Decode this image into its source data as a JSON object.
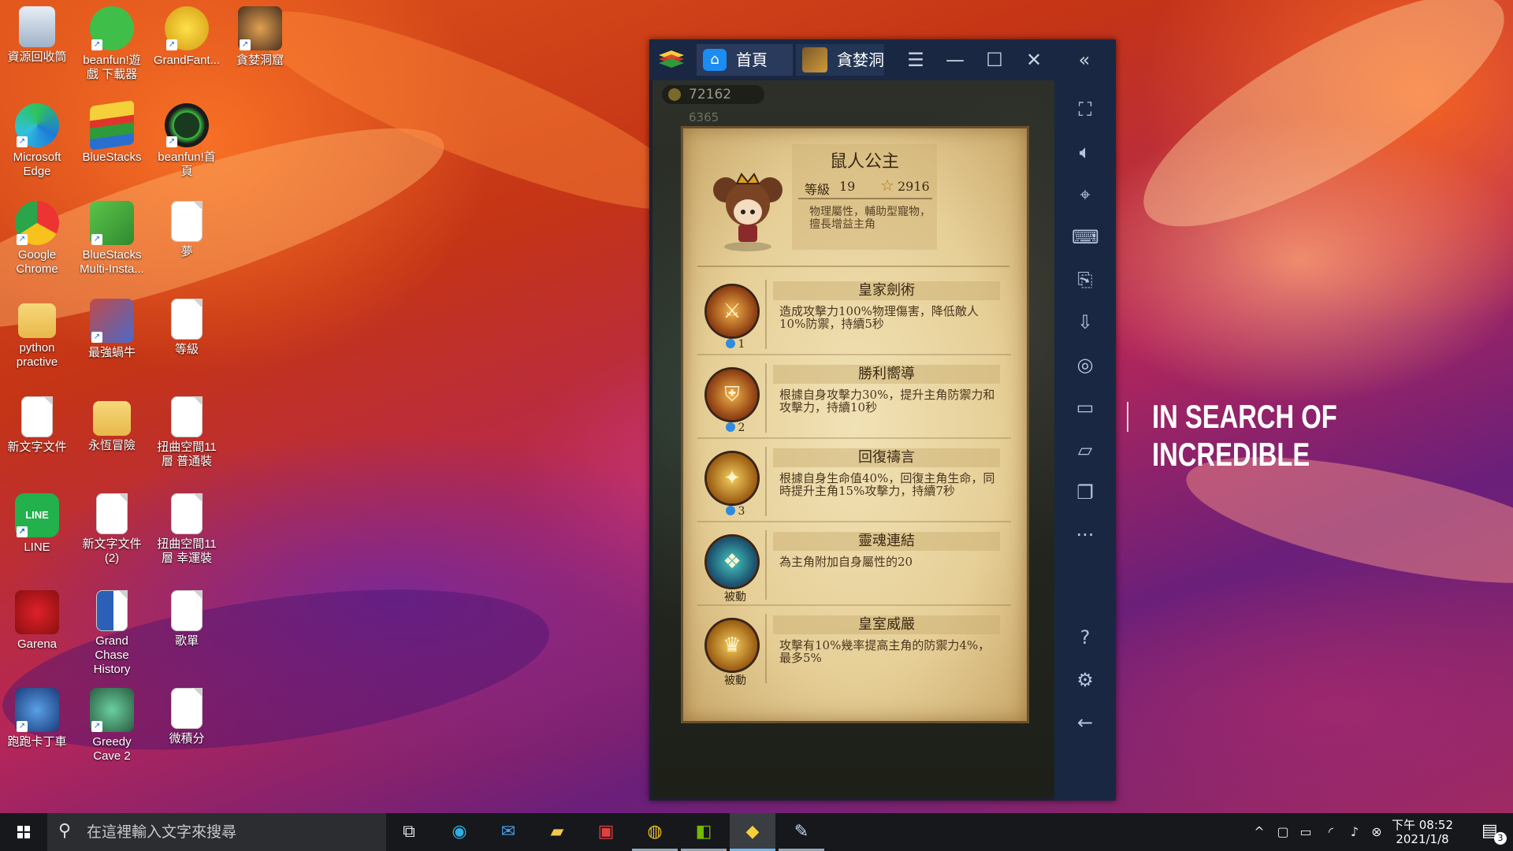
{
  "desktop": {
    "icons": [
      {
        "label": "資源回收筒",
        "icon": "recycle-bin-icon"
      },
      {
        "label": "beanfun!遊戲 下載器",
        "icon": "gamepad-icon"
      },
      {
        "label": "GrandFant...",
        "icon": "game-character-icon"
      },
      {
        "label": "貪婪洞窟",
        "icon": "game-character-icon"
      },
      {
        "label": "Microsoft Edge",
        "icon": "edge-icon"
      },
      {
        "label": "BlueStacks",
        "icon": "bluestacks-icon"
      },
      {
        "label": "beanfun!首頁",
        "icon": "beanfun-icon"
      },
      {
        "label": "Google Chrome",
        "icon": "chrome-icon"
      },
      {
        "label": "BlueStacks Multi-Insta...",
        "icon": "bluestacks-multi-icon"
      },
      {
        "label": "夢",
        "icon": "text-file-icon"
      },
      {
        "label": "python practive",
        "icon": "folder-icon"
      },
      {
        "label": "最強蝸牛",
        "icon": "game-character-icon"
      },
      {
        "label": "等級",
        "icon": "text-file-icon"
      },
      {
        "label": "新文字文件",
        "icon": "text-file-icon"
      },
      {
        "label": "永恆冒險",
        "icon": "folder-icon"
      },
      {
        "label": "扭曲空間11層 普通裝",
        "icon": "text-file-icon"
      },
      {
        "label": "LINE",
        "icon": "line-icon"
      },
      {
        "label": "新文字文件 (2)",
        "icon": "text-file-icon"
      },
      {
        "label": "扭曲空間11層 幸運裝",
        "icon": "text-file-icon"
      },
      {
        "label": "Garena",
        "icon": "garena-icon"
      },
      {
        "label": "Grand Chase History",
        "icon": "word-doc-icon"
      },
      {
        "label": "歌單",
        "icon": "text-file-icon"
      },
      {
        "label": "跑跑卡丁車",
        "icon": "game-character-icon"
      },
      {
        "label": "Greedy Cave 2",
        "icon": "game-character-icon"
      },
      {
        "label": "微積分",
        "icon": "text-file-icon"
      }
    ],
    "wallpaper_slogan": "IN SEARCH OF INCREDIBLE"
  },
  "emulator": {
    "tabs": [
      {
        "label": "首頁",
        "icon": "home-icon"
      },
      {
        "label": "貪婪洞",
        "icon": "game-tab-icon"
      }
    ],
    "window_controls": [
      "menu-icon",
      "minimize-icon",
      "maximize-icon",
      "close-icon",
      "collapse-sidebar-icon"
    ],
    "sidebar_tools": [
      "fullscreen-icon",
      "volume-icon",
      "pointer-icon",
      "keyboard-icon",
      "install-apk-icon",
      "apk-file-icon",
      "screenshot-icon",
      "record-icon",
      "folder-icon",
      "multi-instance-icon",
      "more-icon",
      "help-icon",
      "settings-icon",
      "back-icon"
    ]
  },
  "game": {
    "coins": "72162",
    "gems": "6365",
    "pet": {
      "name": "鼠人公主",
      "level_label": "等級",
      "level": "19",
      "power": "2916",
      "description": "物理屬性，輔助型寵物，擅長增益主角"
    },
    "skills": [
      {
        "name": "皇家劍術",
        "desc": "造成攻擊力100%物理傷害，降低敵人10%防禦，持續5秒",
        "unlock": "1",
        "icon": "sword-skill-icon"
      },
      {
        "name": "勝利嚮導",
        "desc": "根據自身攻擊力30%，提升主角防禦力和攻擊力，持續10秒",
        "unlock": "2",
        "icon": "shield-sword-skill-icon"
      },
      {
        "name": "回復禱言",
        "desc": "根據自身生命值40%，回復主角生命，同時提升主角15%攻擊力，持續7秒",
        "unlock": "3",
        "icon": "prayer-skill-icon"
      },
      {
        "name": "靈魂連結",
        "desc": "為主角附加自身屬性的20",
        "unlock": "被動",
        "icon": "soul-link-skill-icon"
      },
      {
        "name": "皇室威嚴",
        "desc": "攻擊有10%幾率提高主角的防禦力4%，最多5%",
        "unlock": "被動",
        "icon": "crown-shield-skill-icon"
      }
    ]
  },
  "taskbar": {
    "search_placeholder": "在這裡輸入文字來搜尋",
    "apps": [
      "task-view-icon",
      "edge-icon",
      "mail-icon",
      "file-explorer-icon",
      "gift-icon",
      "chrome-icon",
      "nvidia-icon",
      "bluestacks-icon",
      "paint-icon"
    ],
    "time": "下午 08:52",
    "date": "2021/1/8",
    "notifications": "3"
  },
  "colors": {
    "emulator_chrome": "#1a2742",
    "taskbar": "#16181c",
    "parchment": "#ecdcaa"
  }
}
